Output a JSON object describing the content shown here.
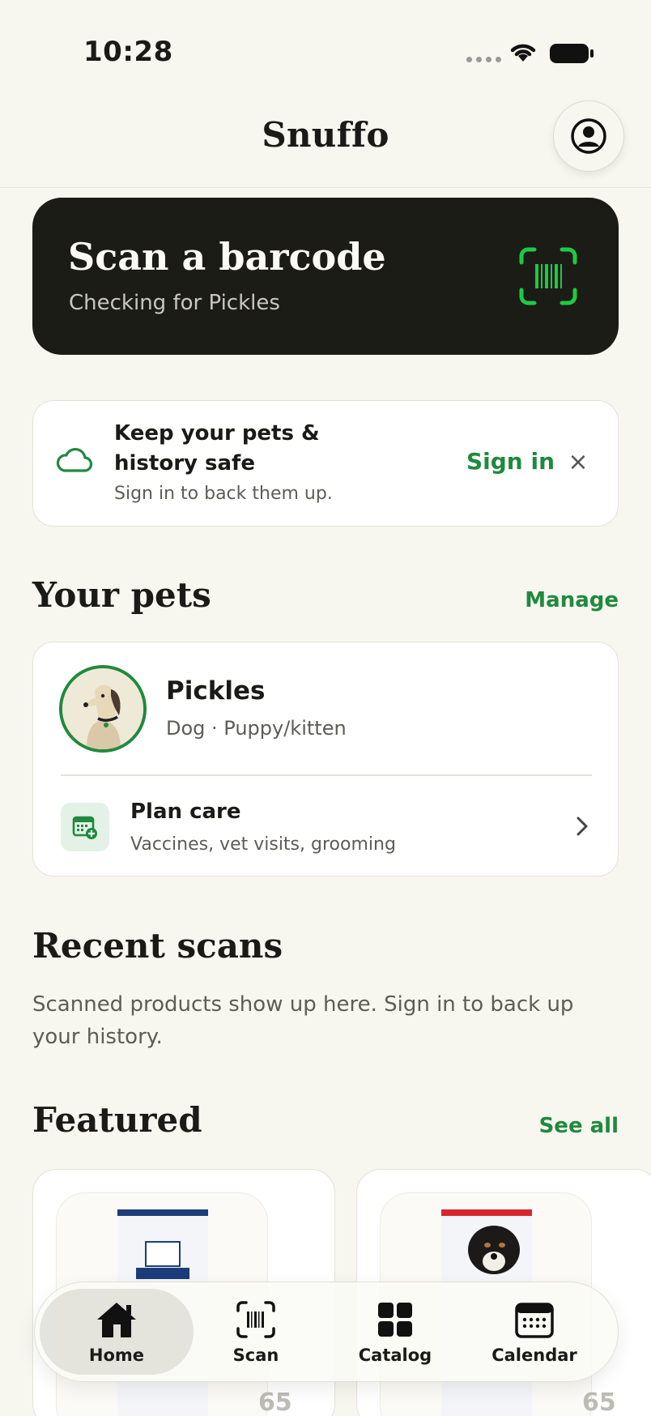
{
  "status_bar": {
    "time": "10:28"
  },
  "header": {
    "title": "Snuffo",
    "profile_icon": "person-circle-icon"
  },
  "scan_card": {
    "title": "Scan a barcode",
    "subtitle": "Checking for Pickles",
    "icon": "barcode-scan-icon",
    "accent": "#1fc943"
  },
  "signin_banner": {
    "title": "Keep your pets & history safe",
    "subtitle": "Sign in to back them up.",
    "action": "Sign in",
    "close": "×",
    "icon": "cloud-icon"
  },
  "pets": {
    "title": "Your pets",
    "manage": "Manage",
    "items": [
      {
        "name": "Pickles",
        "description": "Dog · Puppy/kitten"
      }
    ],
    "plan": {
      "title": "Plan care",
      "subtitle": "Vaccines, vet visits, grooming"
    }
  },
  "recent": {
    "title": "Recent scans",
    "text": "Scanned products show up here. Sign in to back up your history."
  },
  "featured": {
    "title": "Featured",
    "see_all": "See all",
    "items": [
      {
        "score": "65"
      },
      {
        "score": "65"
      }
    ]
  },
  "tabs": [
    {
      "label": "Home",
      "icon": "home-icon",
      "active": true
    },
    {
      "label": "Scan",
      "icon": "barcode-icon",
      "active": false
    },
    {
      "label": "Catalog",
      "icon": "grid-icon",
      "active": false
    },
    {
      "label": "Calendar",
      "icon": "calendar-icon",
      "active": false
    }
  ],
  "colors": {
    "brand_green": "#1f8a3d",
    "background": "#f7f6ef",
    "dark_card": "#1c1c17"
  }
}
